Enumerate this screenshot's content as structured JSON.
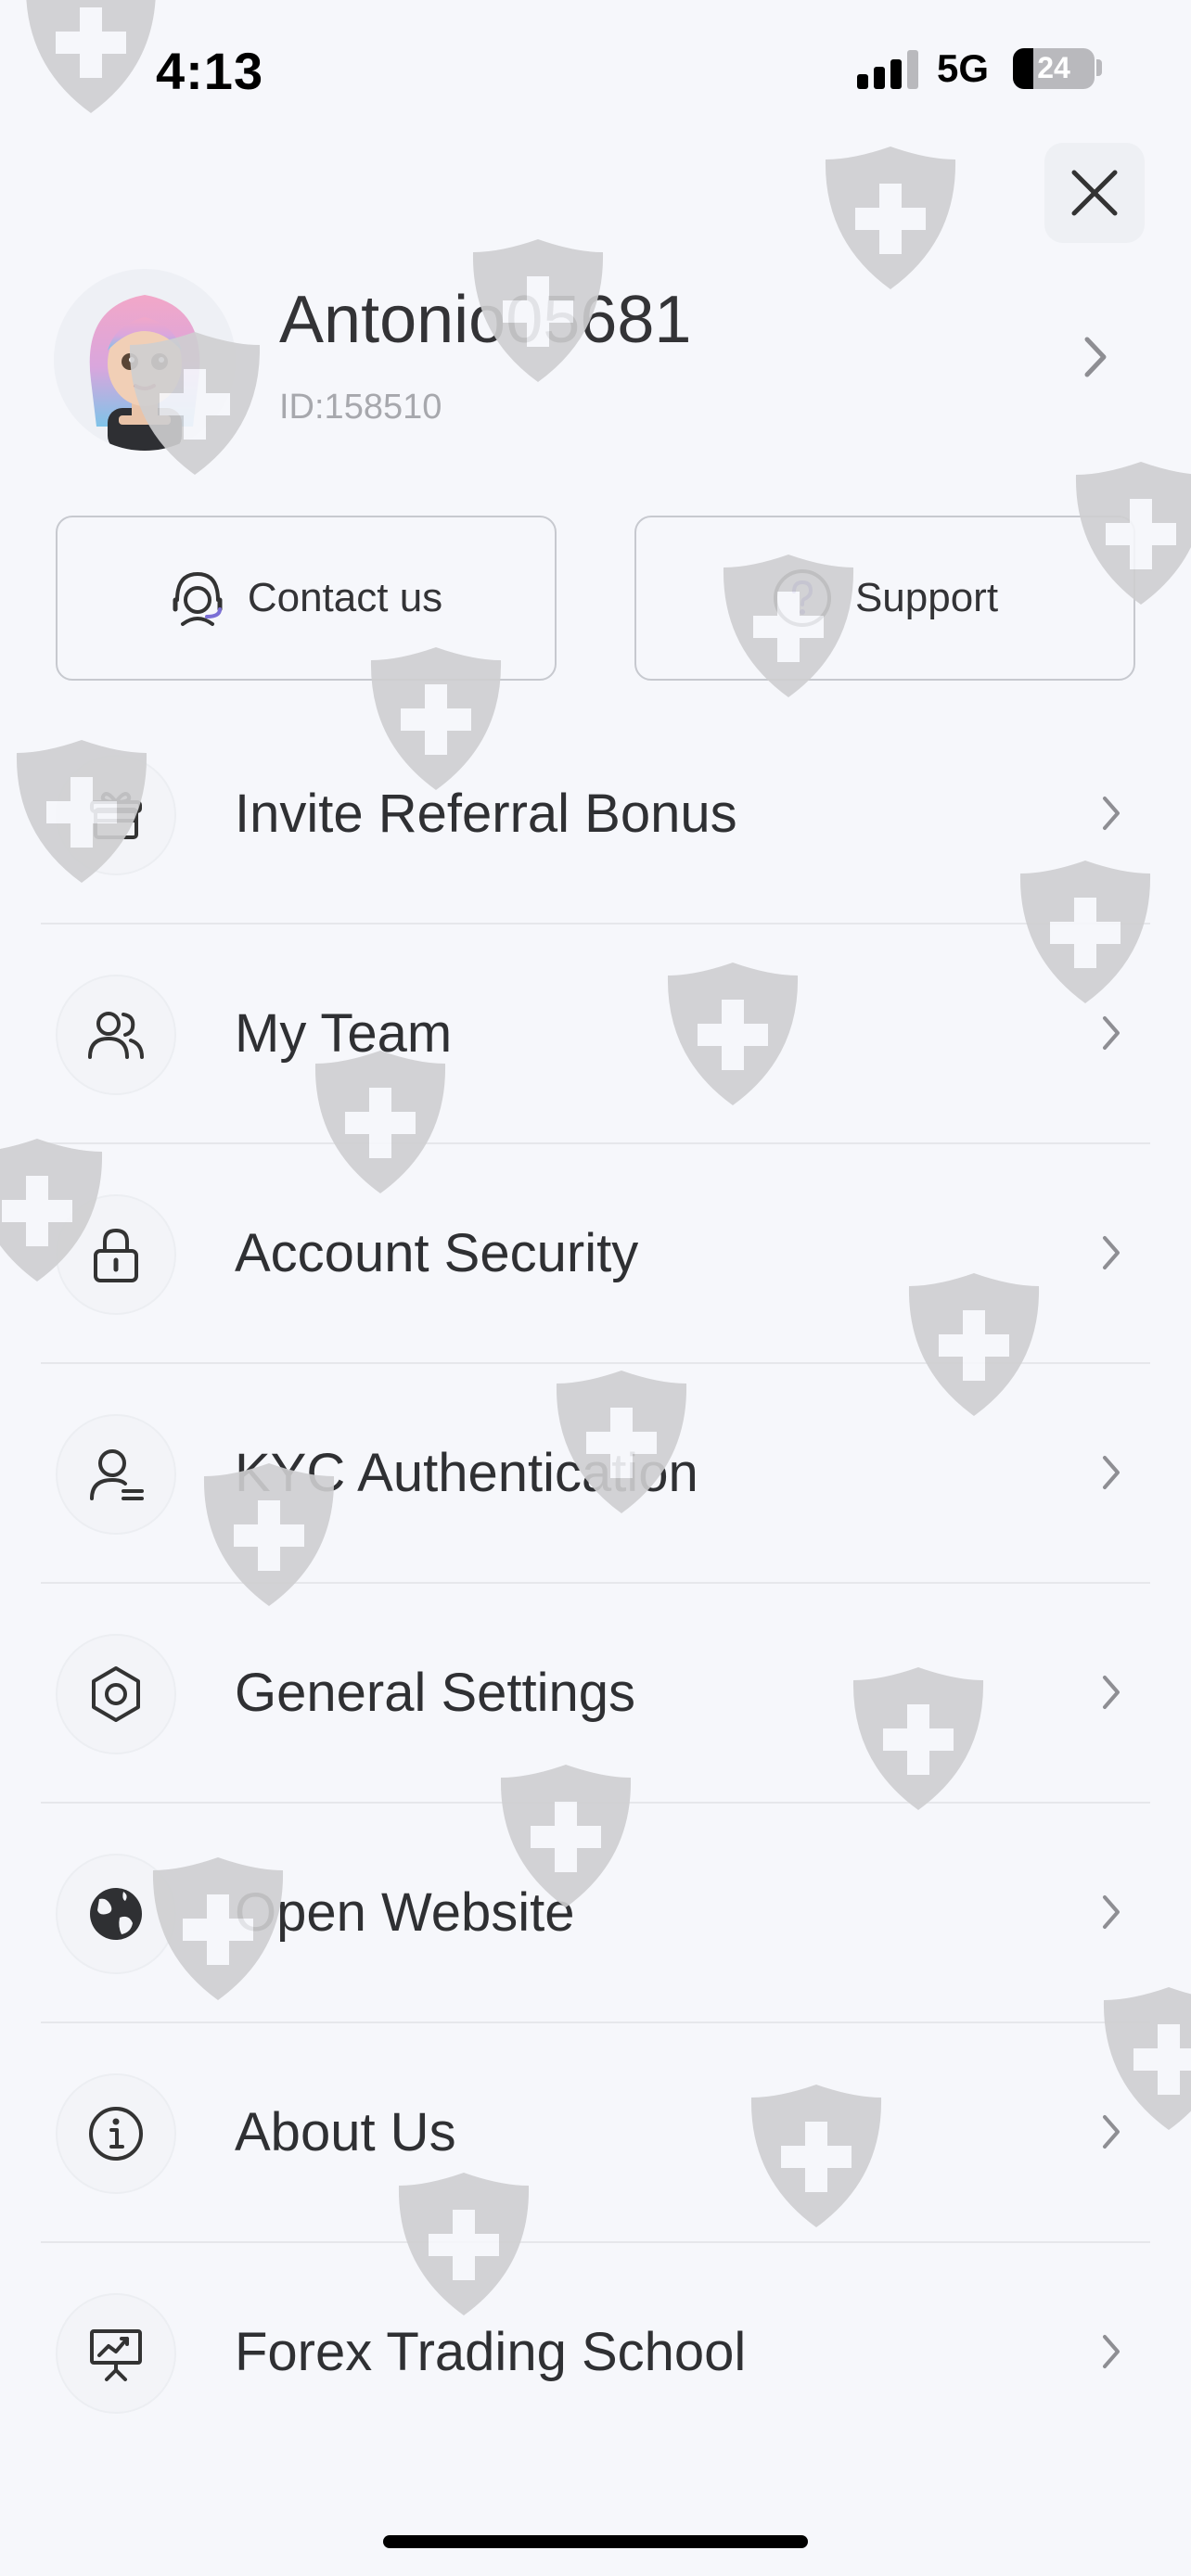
{
  "status_bar": {
    "time": "4:13",
    "network": "5G",
    "battery": "24"
  },
  "profile": {
    "username": "Antonio05681",
    "user_id": "ID:158510"
  },
  "quick_actions": {
    "contact_label": "Contact us",
    "support_label": "Support"
  },
  "menu": {
    "items": [
      {
        "label": "Invite Referral Bonus",
        "icon": "gift-icon"
      },
      {
        "label": "My Team",
        "icon": "team-icon"
      },
      {
        "label": "Account Security",
        "icon": "lock-icon"
      },
      {
        "label": "KYC Authentication",
        "icon": "user-verify-icon"
      },
      {
        "label": "General Settings",
        "icon": "settings-hexagon-icon"
      },
      {
        "label": "Open Website",
        "icon": "globe-icon"
      },
      {
        "label": "About Us",
        "icon": "info-icon"
      },
      {
        "label": "Forex Trading School",
        "icon": "presentation-chart-icon"
      }
    ]
  },
  "colors": {
    "background": "#f6f7fb",
    "text": "#2f3033",
    "muted": "#a7a8ad",
    "accent": "#7b6fd6",
    "watermark": "#cfcfd1"
  }
}
